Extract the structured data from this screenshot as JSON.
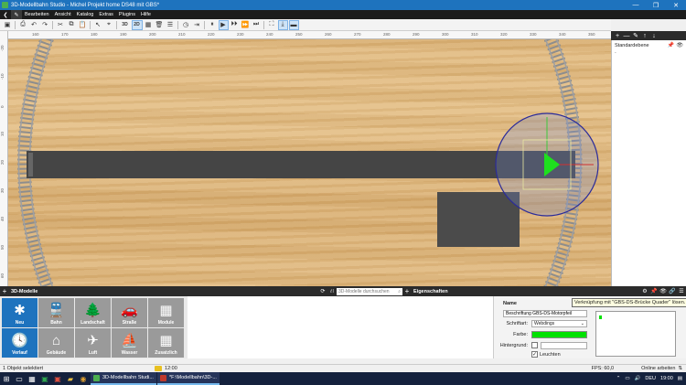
{
  "window": {
    "title": "3D-Modellbahn Studio - Michel Projekt home DS48 mit GBS*",
    "controls": [
      "—",
      "❐",
      "✕"
    ]
  },
  "menu": {
    "items": [
      "Bearbeiten",
      "Ansicht",
      "Katalog",
      "Extras",
      "Plugins",
      "Hilfe"
    ]
  },
  "toolbar": {
    "mode_3d": "3D",
    "mode_2d": "2D"
  },
  "ruler": {
    "top_labels": [
      "160",
      "170",
      "180",
      "190",
      "200",
      "210",
      "220",
      "230",
      "240",
      "250",
      "260",
      "270",
      "280",
      "290",
      "300",
      "310",
      "320",
      "330",
      "340",
      "350",
      "360"
    ],
    "left_labels": [
      "-20",
      "-10",
      "0",
      "10",
      "20",
      "30",
      "40",
      "50",
      "60"
    ]
  },
  "right_panel": {
    "layer_name": "Standardebene",
    "layer_sub": "-"
  },
  "dock": {
    "models_title": "3D-Modelle",
    "search_placeholder": "3D-Modelle durchsuchen",
    "properties_title": "Eigenschaften"
  },
  "categories": [
    {
      "label": "Neu",
      "icon": "✱"
    },
    {
      "label": "Bahn",
      "icon": "🚆"
    },
    {
      "label": "Landschaft",
      "icon": "🌲"
    },
    {
      "label": "Straße",
      "icon": "🚗"
    },
    {
      "label": "Module",
      "icon": "▦"
    },
    {
      "label": "Verlauf",
      "icon": "🕓"
    },
    {
      "label": "Gebäude",
      "icon": "⌂"
    },
    {
      "label": "Luft",
      "icon": "✈"
    },
    {
      "label": "Wasser",
      "icon": "⛵"
    },
    {
      "label": "Zusatzlich",
      "icon": "▦"
    }
  ],
  "properties": {
    "name_label": "Name",
    "name_value": "Beschriftung GBS-DS-Motorpfeil",
    "font_label": "Schriftart:",
    "font_value": "Webdings",
    "color_label": "Farbe:",
    "color_value": "#00e100",
    "bg_label": "Hintergrund:",
    "glow_label": "Leuchten",
    "tooltip": "Verknüpfung mit \"GBS-DS-Brücke Quader\" lösen."
  },
  "status": {
    "selection": "1 Objekt selektiert",
    "time": "12:00",
    "fps": "FPS: 60,0",
    "state": "Online arbeiten"
  },
  "taskbar": {
    "task1": "3D-Modellbahn Studi...",
    "task2": "*F:\\Modellbahn\\3D-...",
    "lang": "DEU",
    "clock": "19:00"
  }
}
